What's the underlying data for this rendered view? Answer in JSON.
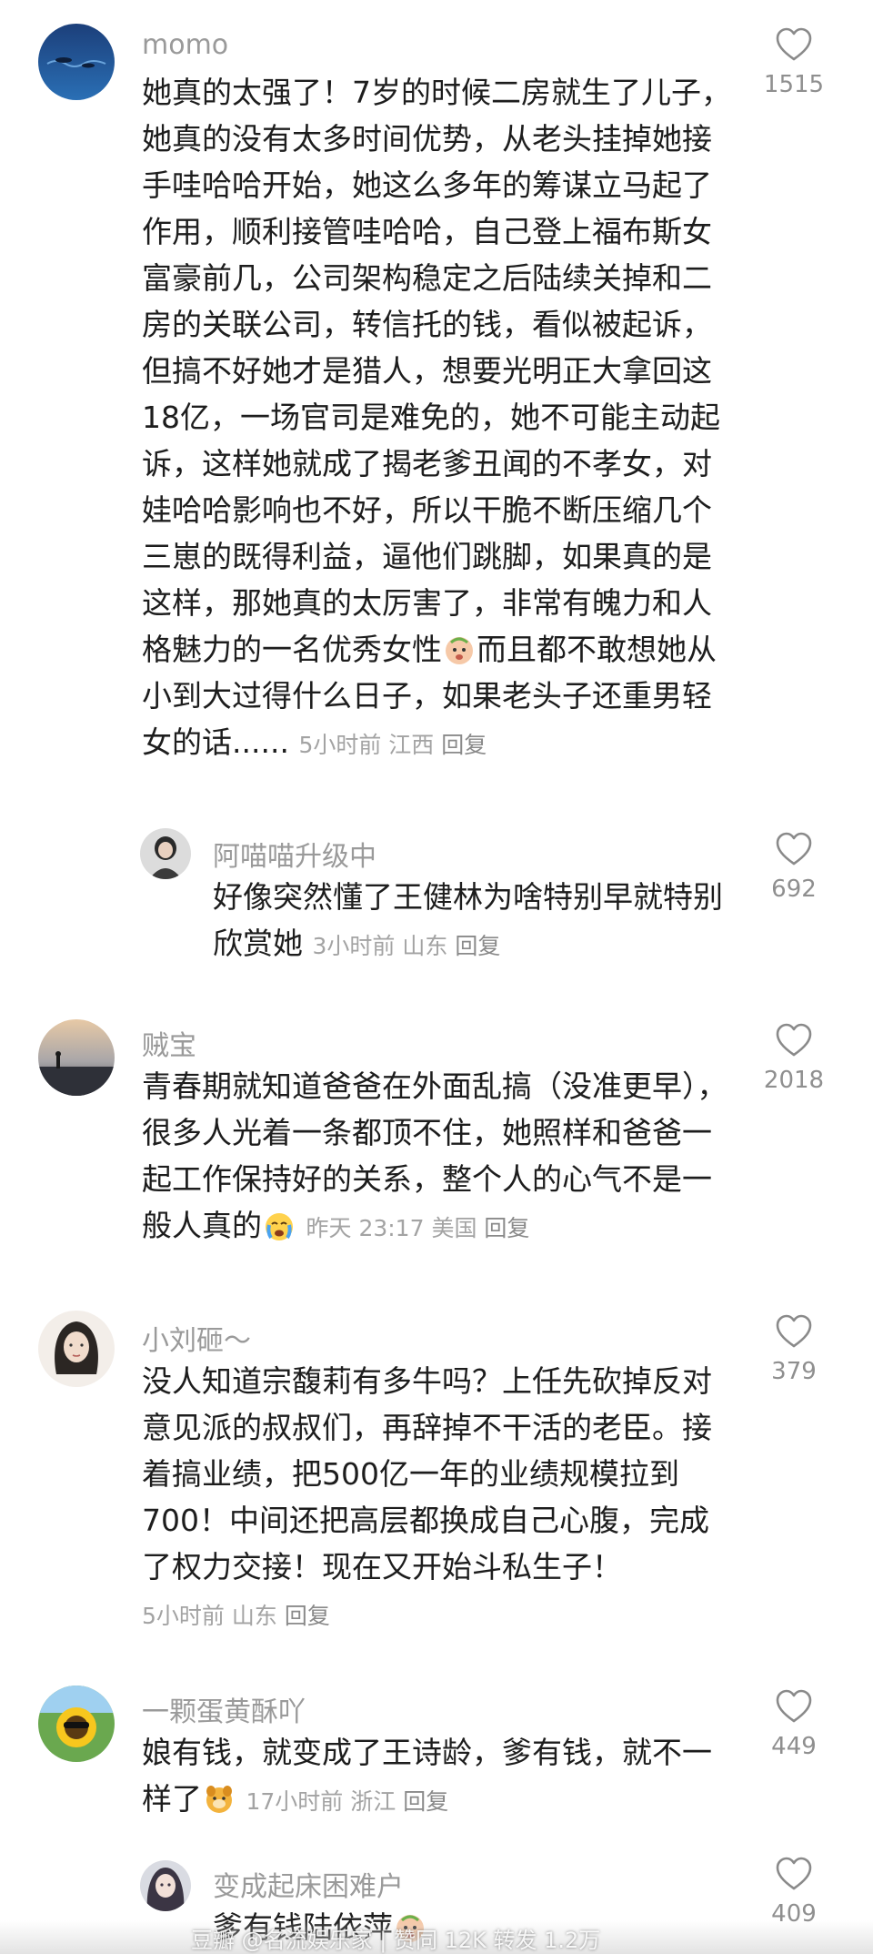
{
  "comments": [
    {
      "user": "momo",
      "lines": [
        "她真的太强了！7岁的时候二房就生了儿子，",
        "她真的没有太多时间优势，从老头挂掉她接",
        "手哇哈哈开始，她这么多年的筹谋立马起了",
        "作用，顺利接管哇哈哈，自己登上福布斯女",
        "富豪前几，公司架构稳定之后陆续关掉和二",
        "房的关联公司，转信托的钱，看似被起诉，",
        "但搞不好她才是猎人，想要光明正大拿回这",
        "18亿，一场官司是难免的，她不可能主动起",
        "诉，这样她就成了揭老爹丑闻的不孝女，对",
        "娃哈哈影响也不好，所以干脆不断压缩几个",
        "三崽的既得利益，逼他们跳脚，如果真的是",
        "这样，那她真的太厉害了，非常有魄力和人",
        "格魅力的一名优秀女性",
        "而且都不敢想她从",
        "小到大过得什么日子，如果老头子还重男轻",
        "女的话......"
      ],
      "meta": "5小时前 江西",
      "reply": "回复",
      "likes": "1515",
      "avatar_icon": "ocean-fish-avatar"
    },
    {
      "user": "阿喵喵升级中",
      "lines": [
        "好像突然懂了王健林为啥特别早就特别",
        "欣赏她"
      ],
      "meta": "3小时前 山东",
      "reply": "回复",
      "likes": "692",
      "avatar_icon": "girl-avatar"
    },
    {
      "user": "贼宝",
      "lines": [
        "青春期就知道爸爸在外面乱搞（没准更早），",
        "很多人光着一条都顶不住，她照样和爸爸一",
        "起工作保持好的关系，整个人的心气不是一",
        "般人真的"
      ],
      "meta": "昨天 23:17 美国",
      "reply": "回复",
      "likes": "2018",
      "avatar_icon": "sunset-beach-avatar"
    },
    {
      "user": "小刘砸～",
      "lines": [
        "没人知道宗馥莉有多牛吗？上任先砍掉反对",
        "意见派的叔叔们，再辞掉不干活的老臣。接",
        "着搞业绩，把500亿一年的业绩规模拉到",
        "700！中间还把高层都换成自己心腹，完成",
        "了权力交接！现在又开始斗私生子！"
      ],
      "meta": "5小时前 山东",
      "reply": "回复",
      "likes": "379",
      "avatar_icon": "sketch-girl-avatar"
    },
    {
      "user": "一颗蛋黄酥吖",
      "lines": [
        "娘有钱，就变成了王诗龄，爹有钱，就不一",
        "样了"
      ],
      "meta": "17小时前 浙江",
      "reply": "回复",
      "likes": "449",
      "avatar_icon": "sunflower-avatar"
    },
    {
      "user": "变成起床困难户",
      "lines": [
        "爹有钱陆依萍"
      ],
      "meta": "",
      "reply": "",
      "likes": "409",
      "avatar_icon": "anime-girl-avatar"
    }
  ],
  "watermark": "豆瓣  @名流娱乐家 | 赞同 12K 转发 1.2万",
  "colors": {
    "username": "#9a9a9a",
    "text": "#1d1d1d",
    "meta": "#a3a3a3",
    "heart_stroke": "#8a8a8a"
  }
}
